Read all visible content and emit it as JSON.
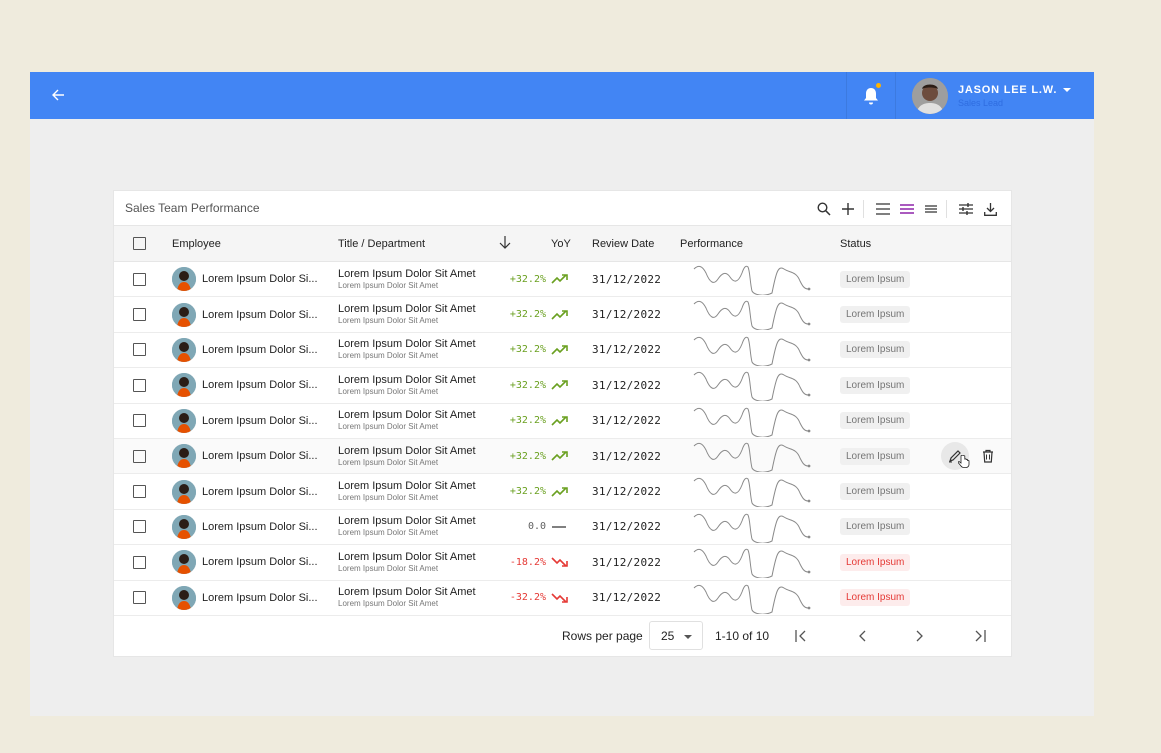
{
  "appbar": {
    "user_name": "JASON LEE L.W.",
    "user_role": "Sales Lead"
  },
  "table": {
    "title": "Sales Team Performance",
    "headers": {
      "employee": "Employee",
      "title": "Title / Department",
      "yoy": "YoY",
      "date": "Review Date",
      "performance": "Performance",
      "status": "Status"
    },
    "rows": [
      {
        "name": "Lorem Ipsum Dolor Si...",
        "title": "Lorem Ipsum Dolor Sit Amet",
        "dept": "Lorem Ipsum Dolor Sit Amet",
        "yoy": "+32.2%",
        "trend": "up",
        "date": "31/12/2022",
        "status": "Lorem Ipsum",
        "status_type": "neutral"
      },
      {
        "name": "Lorem Ipsum Dolor Si...",
        "title": "Lorem Ipsum Dolor Sit Amet",
        "dept": "Lorem Ipsum Dolor Sit Amet",
        "yoy": "+32.2%",
        "trend": "up",
        "date": "31/12/2022",
        "status": "Lorem Ipsum",
        "status_type": "neutral"
      },
      {
        "name": "Lorem Ipsum Dolor Si...",
        "title": "Lorem Ipsum Dolor Sit Amet",
        "dept": "Lorem Ipsum Dolor Sit Amet",
        "yoy": "+32.2%",
        "trend": "up",
        "date": "31/12/2022",
        "status": "Lorem Ipsum",
        "status_type": "neutral"
      },
      {
        "name": "Lorem Ipsum Dolor Si...",
        "title": "Lorem Ipsum Dolor Sit Amet",
        "dept": "Lorem Ipsum Dolor Sit Amet",
        "yoy": "+32.2%",
        "trend": "up",
        "date": "31/12/2022",
        "status": "Lorem Ipsum",
        "status_type": "neutral"
      },
      {
        "name": "Lorem Ipsum Dolor Si...",
        "title": "Lorem Ipsum Dolor Sit Amet",
        "dept": "Lorem Ipsum Dolor Sit Amet",
        "yoy": "+32.2%",
        "trend": "up",
        "date": "31/12/2022",
        "status": "Lorem Ipsum",
        "status_type": "neutral"
      },
      {
        "name": "Lorem Ipsum Dolor Si...",
        "title": "Lorem Ipsum Dolor Sit Amet",
        "dept": "Lorem Ipsum Dolor Sit Amet",
        "yoy": "+32.2%",
        "trend": "up",
        "date": "31/12/2022",
        "status": "Lorem Ipsum",
        "status_type": "neutral",
        "hover": true
      },
      {
        "name": "Lorem Ipsum Dolor Si...",
        "title": "Lorem Ipsum Dolor Sit Amet",
        "dept": "Lorem Ipsum Dolor Sit Amet",
        "yoy": "+32.2%",
        "trend": "up",
        "date": "31/12/2022",
        "status": "Lorem Ipsum",
        "status_type": "neutral"
      },
      {
        "name": "Lorem Ipsum Dolor Si...",
        "title": "Lorem Ipsum Dolor Sit Amet",
        "dept": "Lorem Ipsum Dolor Sit Amet",
        "yoy": "0.0",
        "trend": "flat",
        "date": "31/12/2022",
        "status": "Lorem Ipsum",
        "status_type": "neutral"
      },
      {
        "name": "Lorem Ipsum Dolor Si...",
        "title": "Lorem Ipsum Dolor Sit Amet",
        "dept": "Lorem Ipsum Dolor Sit Amet",
        "yoy": "-18.2%",
        "trend": "down",
        "date": "31/12/2022",
        "status": "Lorem Ipsum",
        "status_type": "negative"
      },
      {
        "name": "Lorem Ipsum Dolor Si...",
        "title": "Lorem Ipsum Dolor Sit Amet",
        "dept": "Lorem Ipsum Dolor Sit Amet",
        "yoy": "-32.2%",
        "trend": "down",
        "date": "31/12/2022",
        "status": "Lorem Ipsum",
        "status_type": "negative"
      }
    ]
  },
  "pagination": {
    "rows_per_page_label": "Rows per page",
    "rows_per_page_value": "25",
    "range": "1-10 of 10"
  },
  "colors": {
    "appbar": "#4285f4",
    "positive": "#6aa020",
    "negative": "#e53935",
    "accent": "#8e24aa",
    "notification_dot": "#ffb300"
  },
  "icons": [
    "back-arrow-icon",
    "bell-icon",
    "search-icon",
    "plus-icon",
    "density-icon",
    "filter-icon",
    "download-icon",
    "sort-arrow-icon",
    "trend-up-icon",
    "trend-flat-icon",
    "trend-down-icon",
    "edit-icon",
    "delete-icon",
    "first-page-icon",
    "prev-page-icon",
    "next-page-icon",
    "last-page-icon"
  ]
}
